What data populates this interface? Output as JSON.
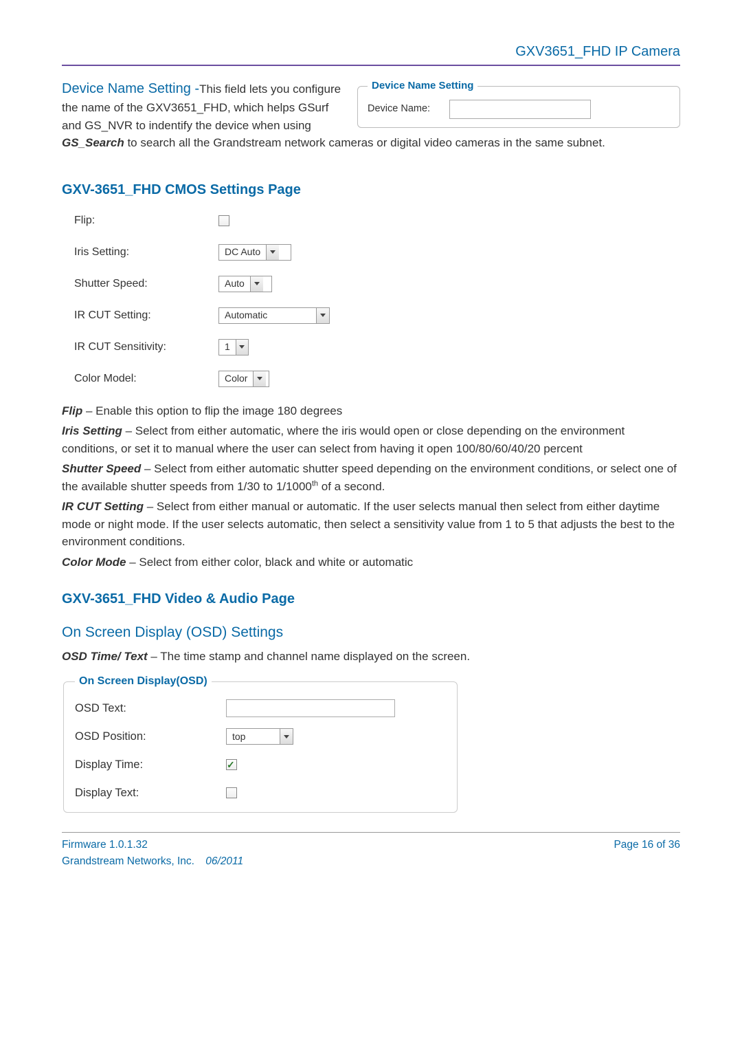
{
  "header": {
    "title": "GXV3651_FHD IP Camera"
  },
  "section_dns": {
    "heading_colored": "Device Name Setting -",
    "heading_plain": "This field lets you configure the name of the GXV3651_FHD, which helps GSurf and GS_NVR to indentify the device when using ",
    "heading_bold": "GS_Search",
    "heading_tail": " to search all the Grandstream network cameras or digital video cameras in the same subnet.",
    "fieldset_legend": "Device Name Setting",
    "devname_label": "Device Name:"
  },
  "section_cmos": {
    "heading": "GXV-3651_FHD CMOS Settings Page",
    "rows": {
      "flip_label": "Flip:",
      "iris_label": "Iris Setting:",
      "iris_value": "DC Auto",
      "shutter_label": "Shutter Speed:",
      "shutter_value": "Auto",
      "ircut_label": "IR CUT Setting:",
      "ircut_value": "Automatic",
      "ircutsens_label": "IR CUT Sensitivity:",
      "ircutsens_value": "1",
      "color_label": "Color Model:",
      "color_value": "Color"
    },
    "desc": {
      "flip_term": "Flip",
      "flip_text": " – Enable this option to flip the image 180 degrees",
      "iris_term": "Iris Setting",
      "iris_text": " – Select from either automatic, where the iris would open or close depending on the environment conditions, or set it to manual where the user can select from having it open 100/80/60/40/20 percent",
      "shutter_term": "Shutter Speed",
      "shutter_text_a": " – Select from either automatic shutter speed depending on the environment conditions, or select one of the available shutter speeds from 1/30 to 1/1000",
      "shutter_sup": "th",
      "shutter_text_b": " of a second.",
      "ircut_term": "IR CUT Setting",
      "ircut_text": " – Select from either manual or automatic. If the user selects manual then select from either daytime mode or night mode. If the user selects automatic, then select a sensitivity value from 1 to 5 that adjusts the best to the environment conditions.",
      "color_term": "Color Mode",
      "color_text": " – Select from either color, black and white or automatic"
    }
  },
  "section_va": {
    "heading": "GXV-3651_FHD Video & Audio Page",
    "osd_subheading": "On Screen Display (OSD) Settings",
    "osd_desc_term": "OSD Time/ Text",
    "osd_desc_text": " – The time stamp and channel name displayed on the screen.",
    "osd_legend": "On Screen Display(OSD)",
    "osd_text_label": "OSD Text:",
    "osd_pos_label": "OSD Position:",
    "osd_pos_value": "top",
    "disp_time_label": "Display Time:",
    "disp_text_label": "Display Text:"
  },
  "footer": {
    "firmware": "Firmware 1.0.1.32",
    "page": "Page 16 of 36",
    "company": "Grandstream Networks, Inc.",
    "date": "06/2011"
  }
}
